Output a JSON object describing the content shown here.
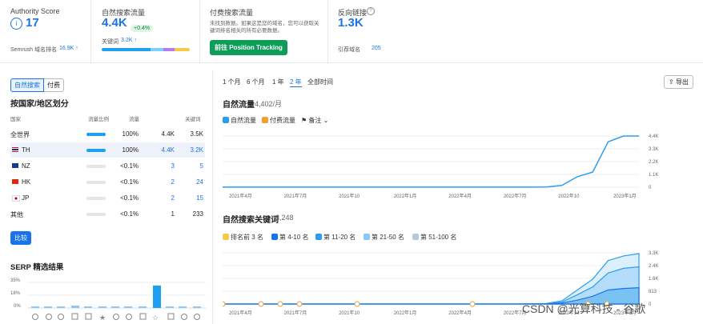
{
  "metrics": {
    "authority": {
      "label": "Authority Score",
      "value": "17",
      "sub_label": "Semrush 域名排名",
      "sub_value": "16.9K ↑"
    },
    "organic": {
      "label": "自然搜索流量",
      "value": "4.4K",
      "change": "+0.4%",
      "sub_label": "关键词",
      "sub_value": "3.2K ↑"
    },
    "paid": {
      "label": "付费搜索流量",
      "desc": "未找到数据。如果这是您的域名，您可以获取关键词排名相关的所有必要数据。",
      "button": "前往 Position Tracking"
    },
    "backlinks": {
      "label": "反向链接",
      "value": "1.3K",
      "sub_label": "引荐域名",
      "sub_value": "205"
    }
  },
  "segmented": {
    "organic": "自然搜索",
    "paid": "付费"
  },
  "ranges": [
    "1 个月",
    "6 个月",
    "1 年",
    "2 年",
    "全部时间"
  ],
  "export": "导出",
  "country": {
    "title": "按国家/地区划分",
    "headers": [
      "国家",
      "流量比例",
      "流量",
      "关键词"
    ],
    "rows": [
      {
        "name": "全世界",
        "share": "100%",
        "traffic": "4.4K",
        "keywords": "3.5K"
      },
      {
        "name": "TH",
        "share": "100%",
        "traffic": "4.4K",
        "keywords": "3.2K"
      },
      {
        "name": "NZ",
        "share": "<0.1%",
        "traffic": "3",
        "keywords": "5"
      },
      {
        "name": "HK",
        "share": "<0.1%",
        "traffic": "2",
        "keywords": "24"
      },
      {
        "name": "JP",
        "share": "<0.1%",
        "traffic": "2",
        "keywords": "15"
      },
      {
        "name": "其他",
        "share": "<0.1%",
        "traffic": "1",
        "keywords": "233"
      }
    ],
    "compare": "比较"
  },
  "serp": {
    "title": "SERP 精选结果",
    "ticks": [
      "35%",
      "18%",
      "0%"
    ]
  },
  "traffic_chart": {
    "title": "自然流量",
    "subtitle": "4,402/月",
    "legend": {
      "organic": "自然流量",
      "paid": "付费流量",
      "notes": "备注"
    }
  },
  "keywords_chart": {
    "title": "自然搜索关键词",
    "subtitle": "3,248",
    "legend": [
      "排名前 3 名",
      "第 4-10 名",
      "第 11-20 名",
      "第 21-50 名",
      "第 51-100 名"
    ]
  },
  "watermark": "CSDN @光算科技 - 谷歌",
  "colors": {
    "accent": "#1a73e8",
    "line": "#2e9df0",
    "green": "#0c9d58",
    "orange": "#f0a030"
  },
  "chart_data": [
    {
      "type": "line",
      "title": "自然流量",
      "x": [
        "2021年4月",
        "2021年7月",
        "2021年10",
        "2022年1月",
        "2022年4月",
        "2022年7月",
        "2022年10",
        "2023年1月"
      ],
      "yticks": [
        "4.4K",
        "3.3K",
        "2.2K",
        "1.1K",
        "0"
      ],
      "ylim": [
        0,
        4400
      ],
      "series": [
        {
          "name": "自然流量",
          "values": [
            5,
            5,
            5,
            5,
            5,
            5,
            5,
            5,
            5,
            5,
            5,
            5,
            5,
            5,
            5,
            5,
            5,
            5,
            5,
            5,
            8,
            20,
            150,
            900,
            1300,
            3900,
            4402,
            4402
          ]
        }
      ]
    },
    {
      "type": "area",
      "title": "自然搜索关键词",
      "x": [
        "2021年4月",
        "2021年7月",
        "2021年10",
        "2022年1月",
        "2022年4月",
        "2022年7月",
        "2022年10",
        "2023年1月"
      ],
      "yticks": [
        "3.3K",
        "2.4K",
        "1.6K",
        "813",
        "0"
      ],
      "ylim": [
        0,
        3300
      ],
      "series": [
        {
          "name": "第 51-100 名",
          "values": [
            0,
            0,
            0,
            0,
            0,
            0,
            0,
            0,
            0,
            0,
            0,
            0,
            0,
            0,
            0,
            0,
            0,
            0,
            0,
            0,
            10,
            30,
            200,
            900,
            1600,
            2800,
            3100,
            3248
          ]
        },
        {
          "name": "第 21-50 名",
          "values": [
            0,
            0,
            0,
            0,
            0,
            0,
            0,
            0,
            0,
            0,
            0,
            0,
            0,
            0,
            0,
            0,
            0,
            0,
            0,
            0,
            5,
            15,
            120,
            600,
            1100,
            2000,
            2300,
            2400
          ]
        },
        {
          "name": "第 11-20 名",
          "values": [
            0,
            0,
            0,
            0,
            0,
            0,
            0,
            0,
            0,
            0,
            0,
            0,
            0,
            0,
            0,
            0,
            0,
            0,
            0,
            0,
            3,
            8,
            60,
            250,
            500,
            900,
            1000,
            1050
          ]
        }
      ]
    }
  ]
}
